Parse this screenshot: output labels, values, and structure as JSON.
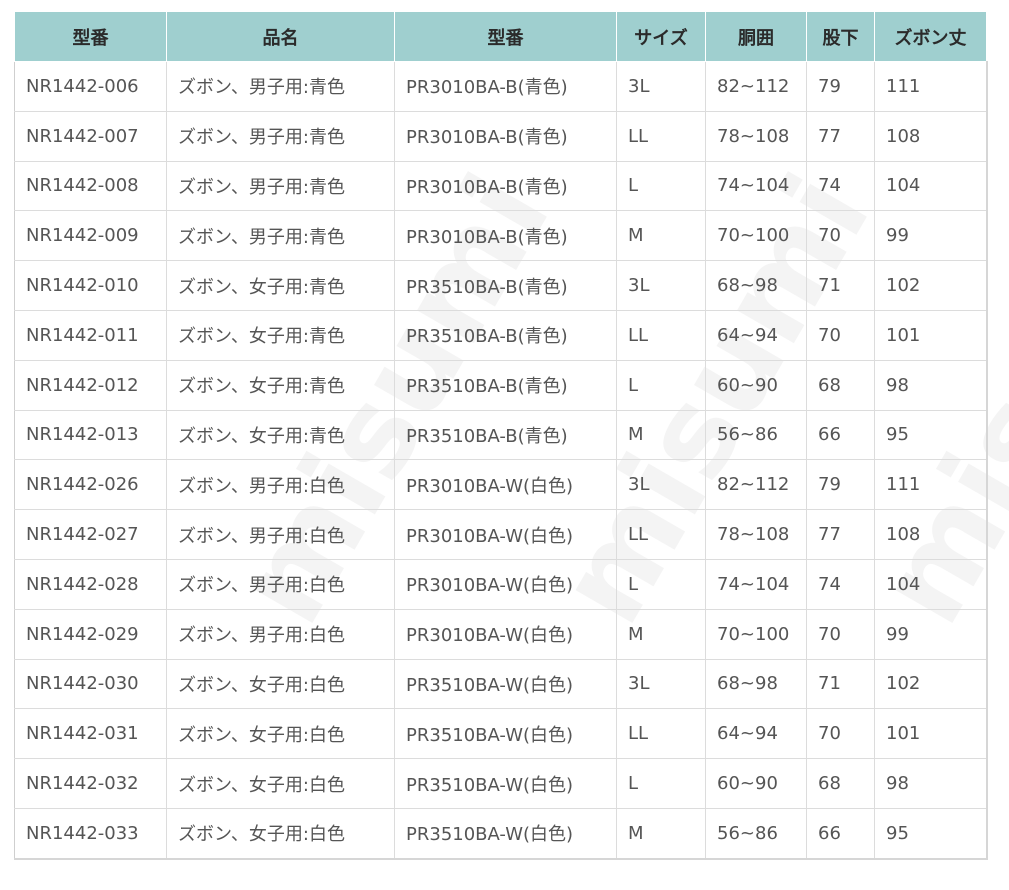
{
  "table": {
    "headers": [
      "型番",
      "品名",
      "型番",
      "サイズ",
      "胴囲",
      "股下",
      "ズボン丈"
    ],
    "rows": [
      [
        "NR1442-006",
        "ズボン、男子用:青色",
        "PR3010BA-B(青色)",
        "3L",
        "82~112",
        "79",
        "111"
      ],
      [
        "NR1442-007",
        "ズボン、男子用:青色",
        "PR3010BA-B(青色)",
        "LL",
        "78~108",
        "77",
        "108"
      ],
      [
        "NR1442-008",
        "ズボン、男子用:青色",
        "PR3010BA-B(青色)",
        "L",
        "74~104",
        "74",
        "104"
      ],
      [
        "NR1442-009",
        "ズボン、男子用:青色",
        "PR3010BA-B(青色)",
        "M",
        "70~100",
        "70",
        "99"
      ],
      [
        "NR1442-010",
        "ズボン、女子用:青色",
        "PR3510BA-B(青色)",
        "3L",
        "68~98",
        "71",
        "102"
      ],
      [
        "NR1442-011",
        "ズボン、女子用:青色",
        "PR3510BA-B(青色)",
        "LL",
        "64~94",
        "70",
        "101"
      ],
      [
        "NR1442-012",
        "ズボン、女子用:青色",
        "PR3510BA-B(青色)",
        "L",
        "60~90",
        "68",
        "98"
      ],
      [
        "NR1442-013",
        "ズボン、女子用:青色",
        "PR3510BA-B(青色)",
        "M",
        "56~86",
        "66",
        "95"
      ],
      [
        "NR1442-026",
        "ズボン、男子用:白色",
        "PR3010BA-W(白色)",
        "3L",
        "82~112",
        "79",
        "111"
      ],
      [
        "NR1442-027",
        "ズボン、男子用:白色",
        "PR3010BA-W(白色)",
        "LL",
        "78~108",
        "77",
        "108"
      ],
      [
        "NR1442-028",
        "ズボン、男子用:白色",
        "PR3010BA-W(白色)",
        "L",
        "74~104",
        "74",
        "104"
      ],
      [
        "NR1442-029",
        "ズボン、男子用:白色",
        "PR3010BA-W(白色)",
        "M",
        "70~100",
        "70",
        "99"
      ],
      [
        "NR1442-030",
        "ズボン、女子用:白色",
        "PR3510BA-W(白色)",
        "3L",
        "68~98",
        "71",
        "102"
      ],
      [
        "NR1442-031",
        "ズボン、女子用:白色",
        "PR3510BA-W(白色)",
        "LL",
        "64~94",
        "70",
        "101"
      ],
      [
        "NR1442-032",
        "ズボン、女子用:白色",
        "PR3510BA-W(白色)",
        "L",
        "60~90",
        "68",
        "98"
      ],
      [
        "NR1442-033",
        "ズボン、女子用:白色",
        "PR3510BA-W(白色)",
        "M",
        "56~86",
        "66",
        "95"
      ]
    ]
  },
  "watermark": {
    "text": "misumi"
  },
  "colors": {
    "header_bg": "#9fcfcf",
    "cell_text": "#555555",
    "grid": "#dcdcdc"
  }
}
